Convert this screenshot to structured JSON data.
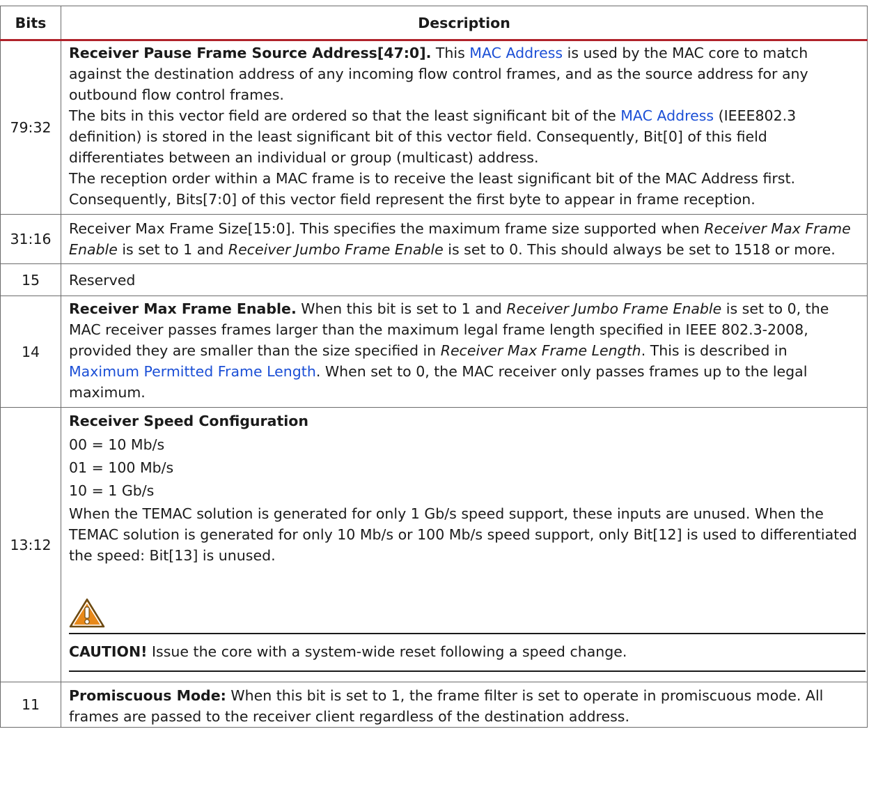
{
  "header": {
    "bits": "Bits",
    "description": "Description"
  },
  "rows": {
    "r0": {
      "bits": "79:32",
      "title": "Receiver Pause Frame Source Address[47:0].",
      "p1_a": " This ",
      "p1_link": "MAC Address",
      "p1_b": " is used by the MAC core to match against the destination address of any incoming flow control frames, and as the source address for any outbound flow control frames.",
      "p2_a": "The bits in this vector field are ordered so that the least significant bit of the ",
      "p2_link": "MAC Address",
      "p2_b": " (IEEE802.3 definition) is stored in the least significant bit of this vector field. Consequently, Bit[0] of this field differentiates between an individual or group (multicast) address.",
      "p3": "The reception order within a MAC frame is to receive the least significant bit of the MAC Address first. Consequently, Bits[7:0] of this vector field represent the first byte to appear in frame reception."
    },
    "r1": {
      "bits": "31:16",
      "t1": "Receiver Max Frame Size[15:0]. This specifies the maximum frame size supported when ",
      "i1": "Receiver Max Frame Enable",
      "t2": " is set to 1 and ",
      "i2": "Receiver Jumbo Frame Enable",
      "t3": " is set to 0. This should always be set to 1518 or more."
    },
    "r2": {
      "bits": "15",
      "text": "Reserved"
    },
    "r3": {
      "bits": "14",
      "title": "Receiver Max Frame Enable.",
      "t1": " When this bit is set to 1 and ",
      "i1": "Receiver Jumbo Frame Enable",
      "t2": " is set to 0, the MAC receiver passes frames larger than the maximum legal frame length specified in IEEE 802.3-2008, provided they are smaller than the size specified in ",
      "i2": "Receiver Max Frame Length",
      "t3": ". This is described in ",
      "link": "Maximum Permitted Frame Length",
      "t4": ". When set to 0, the MAC receiver only passes frames up to the legal maximum."
    },
    "r4": {
      "bits": "13:12",
      "title": "Receiver Speed Configuration",
      "v1": "00 = 10 Mb/s",
      "v2": "01 = 100 Mb/s",
      "v3": "10 = 1 Gb/s",
      "p1": "When the TEMAC solution is generated for only 1 Gb/s speed support, these inputs are unused. When the TEMAC solution is generated for only 10 Mb/s or 100 Mb/s speed support, only Bit[12] is used to differentiated the speed: Bit[13] is unused.",
      "caution_label": "CAUTION!",
      "caution_text": " Issue the core with a system-wide reset following a speed change.",
      "caution_icon": "warning-triangle-icon"
    },
    "r5": {
      "bits": "11",
      "title": "Promiscuous Mode:",
      "text": " When this bit is set to 1, the frame filter is set to operate in promiscuous mode. All frames are passed to the receiver client regardless of the destination address."
    }
  },
  "colors": {
    "header_rule": "#b0222a",
    "link": "#1b4fd6",
    "caution_fill": "#e8891a"
  }
}
